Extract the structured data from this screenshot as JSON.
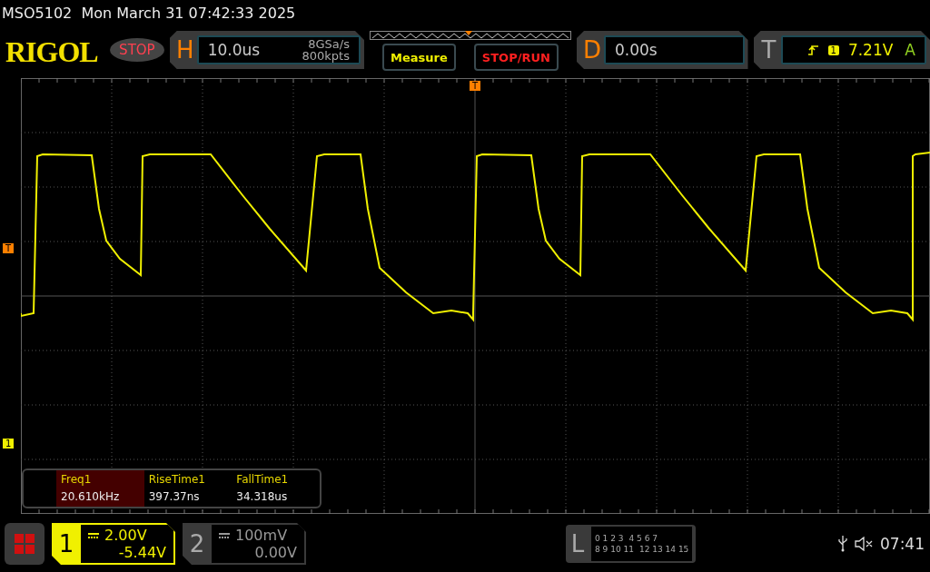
{
  "status_line": "MSO5102  Mon March 31 07:42:33 2025",
  "logo": "RIGOL",
  "run_state": "STOP",
  "horizontal": {
    "label": "H",
    "timebase": "10.0us",
    "sample_rate": "8GSa/s",
    "memory_depth": "800kpts"
  },
  "buttons": [
    {
      "label": "Measure",
      "kind": "menu"
    },
    {
      "label": "STOP/RUN",
      "kind": "run"
    }
  ],
  "delay": {
    "label": "D",
    "value": "0.00s"
  },
  "trigger": {
    "label": "T",
    "source": "1",
    "level": "7.21V",
    "mode": "A"
  },
  "markers": {
    "trigger_position": "T",
    "trigger_level": "T",
    "channel_1": "1"
  },
  "measurements": [
    {
      "name": "Freq1",
      "value": "20.610kHz",
      "selected": true
    },
    {
      "name": "RiseTime1",
      "value": "397.37ns",
      "selected": false
    },
    {
      "name": "FallTime1",
      "value": "34.318us",
      "selected": false
    }
  ],
  "channels": [
    {
      "number": "1",
      "scale": "2.00V",
      "offset": "-5.44V",
      "on": true
    },
    {
      "number": "2",
      "scale": "100mV",
      "offset": "0.00V",
      "on": false
    }
  ],
  "logic": {
    "label": "L",
    "rows": [
      {
        "groups": [
          "0 1 2 3",
          "4 5 6 7"
        ]
      },
      {
        "groups": [
          "8 9 10 11",
          "12 13 14 15"
        ]
      }
    ]
  },
  "clock": "07:41"
}
